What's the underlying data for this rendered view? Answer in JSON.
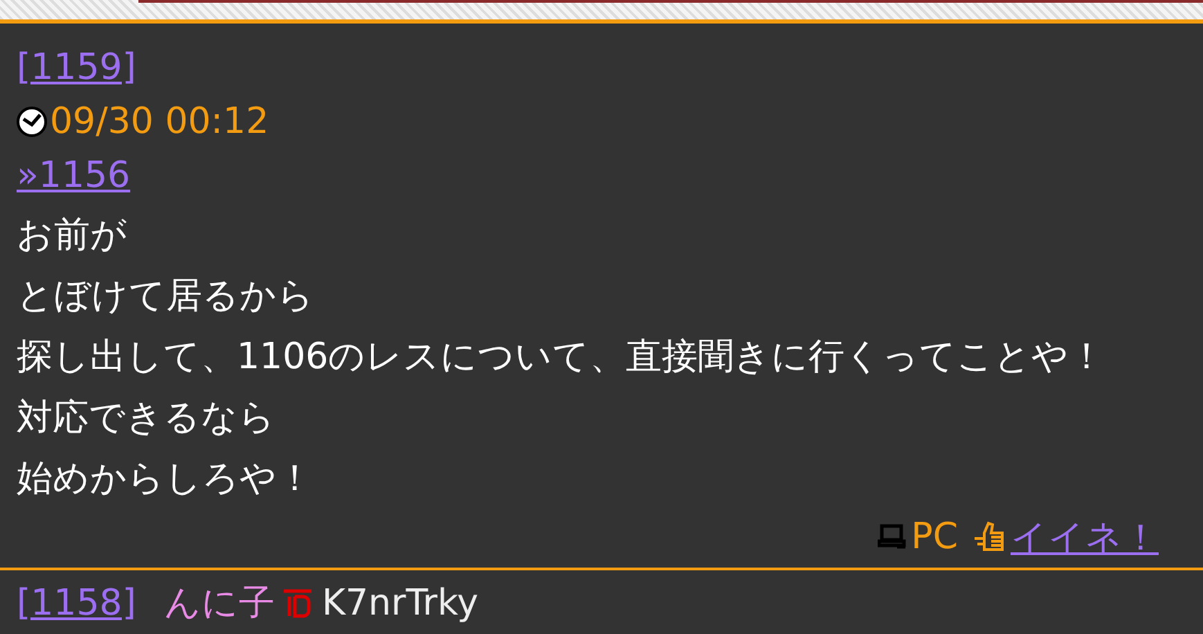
{
  "post": {
    "number": "[1159]",
    "date": "09/30 00:12",
    "anchor": "»1156",
    "lines": [
      "お前が",
      "とぼけて居るから",
      "探し出して、1106のレスについて、直接聞きに行くってことや！",
      "対応できるなら",
      "始めからしろや！"
    ],
    "device": "PC",
    "like": "イイネ！"
  },
  "next_post": {
    "number": "[1158]",
    "name": "んに子",
    "id": "K7nrTrky"
  }
}
